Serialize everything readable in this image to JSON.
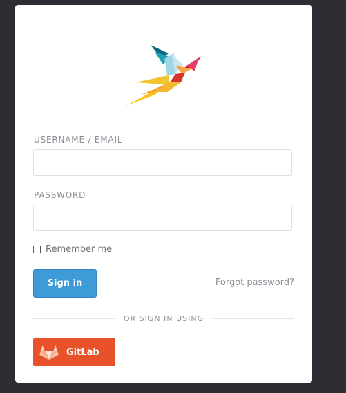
{
  "login": {
    "username_label": "USERNAME / EMAIL",
    "username_value": "",
    "password_label": "PASSWORD",
    "password_value": "",
    "remember_label": "Remember me",
    "remember_checked": false,
    "signin_label": "Sign in",
    "forgot_label": "Forgot password?",
    "divider_label": "OR SIGN IN USING",
    "gitlab_label": "GitLab"
  },
  "colors": {
    "background": "#2c2e33",
    "card": "#ffffff",
    "primary": "#3e9bd8",
    "gitlab": "#e8522b"
  },
  "icons": {
    "logo": "origami-bird-logo",
    "gitlab": "gitlab-fox-icon"
  }
}
